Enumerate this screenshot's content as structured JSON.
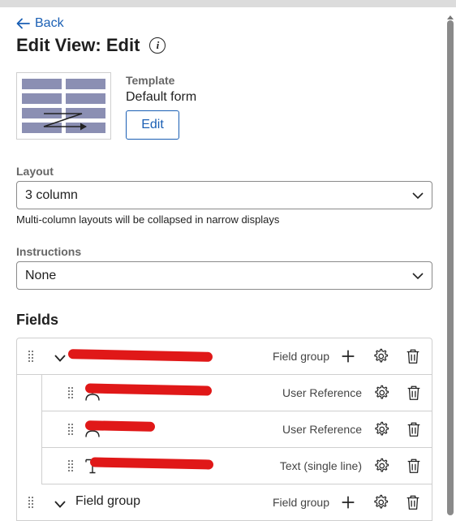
{
  "header": {
    "back_label": "Back",
    "title": "Edit View: Edit"
  },
  "template": {
    "label": "Template",
    "value": "Default form",
    "edit_label": "Edit"
  },
  "layout": {
    "label": "Layout",
    "selected": "3 column",
    "helper": "Multi-column layouts will be collapsed in narrow displays"
  },
  "instructions": {
    "label": "Instructions",
    "selected": "None"
  },
  "fields": {
    "heading": "Fields",
    "rows": [
      {
        "level": 0,
        "icon": "chevron-down-icon",
        "label": "",
        "type": "Field group",
        "can_add": true,
        "redacted": true
      },
      {
        "level": 1,
        "icon": "person-icon",
        "label": "",
        "type": "User Reference",
        "can_add": false,
        "redacted": true
      },
      {
        "level": 1,
        "icon": "person-icon",
        "label": "",
        "type": "User Reference",
        "can_add": false,
        "redacted": true
      },
      {
        "level": 1,
        "icon": "text-icon",
        "label": "",
        "type": "Text (single line)",
        "can_add": false,
        "redacted": true
      },
      {
        "level": 0,
        "icon": "chevron-down-icon",
        "label": "Field group",
        "type": "Field group",
        "can_add": true,
        "redacted": false
      }
    ]
  },
  "colors": {
    "link": "#1a5fb4",
    "redaction": "#e01818"
  }
}
